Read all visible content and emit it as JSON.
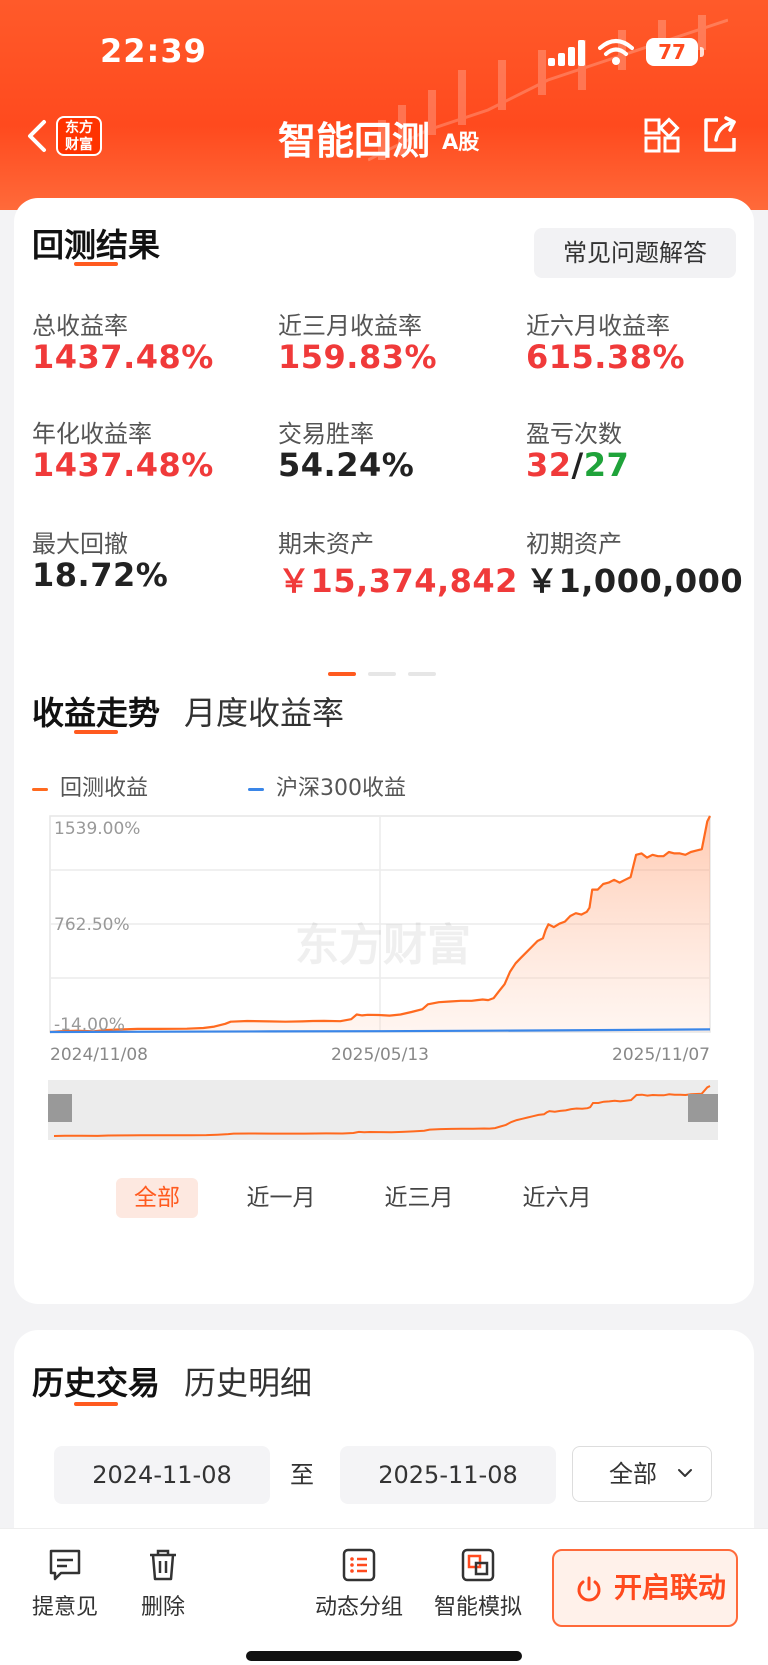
{
  "status": {
    "time": "22:39",
    "battery": "77"
  },
  "nav": {
    "logo_line1": "东方",
    "logo_line2": "财富",
    "title": "智能回测",
    "subtitle": "A股"
  },
  "results": {
    "title": "回测结果",
    "faq_label": "常见问题解答",
    "metrics": [
      {
        "label": "总收益率",
        "value": "1437.48%"
      },
      {
        "label": "近三月收益率",
        "value": "159.83%"
      },
      {
        "label": "近六月收益率",
        "value": "615.38%"
      },
      {
        "label": "年化收益率",
        "value": "1437.48%"
      },
      {
        "label": "交易胜率",
        "value": "54.24%"
      },
      {
        "label": "盈亏次数",
        "win": "32",
        "sep": "/",
        "loss": "27"
      },
      {
        "label": "最大回撤",
        "value": "18.72%"
      },
      {
        "label": "期末资产",
        "value": "￥15,374,842"
      },
      {
        "label": "初期资产",
        "value": "￥1,000,000"
      }
    ]
  },
  "trend": {
    "tab_active": "收益走势",
    "tab_other": "月度收益率",
    "legend_backtest": "回测收益",
    "legend_hs300": "沪深300收益",
    "watermark": "东方财富",
    "range_tabs": [
      "全部",
      "近一月",
      "近三月",
      "近六月"
    ]
  },
  "chart_data": {
    "type": "line",
    "y_ticks": [
      "1539.00%",
      "762.50%",
      "-14.00%"
    ],
    "x_ticks": [
      "2024/11/08",
      "2025/05/13",
      "2025/11/07"
    ],
    "ylim": [
      -14,
      1539
    ],
    "series": [
      {
        "name": "回测收益",
        "color": "#ff6a1f",
        "points": [
          [
            0,
            -14
          ],
          [
            0.02,
            -8
          ],
          [
            0.05,
            -5
          ],
          [
            0.08,
            -10
          ],
          [
            0.1,
            0
          ],
          [
            0.13,
            5
          ],
          [
            0.16,
            8
          ],
          [
            0.2,
            8
          ],
          [
            0.25,
            10
          ],
          [
            0.28,
            15
          ],
          [
            0.3,
            25
          ],
          [
            0.32,
            45
          ],
          [
            0.33,
            60
          ],
          [
            0.36,
            65
          ],
          [
            0.4,
            62
          ],
          [
            0.43,
            60
          ],
          [
            0.46,
            62
          ],
          [
            0.48,
            65
          ],
          [
            0.5,
            66
          ],
          [
            0.53,
            64
          ],
          [
            0.55,
            78
          ],
          [
            0.56,
            112
          ],
          [
            0.57,
            105
          ],
          [
            0.58,
            110
          ],
          [
            0.6,
            108
          ],
          [
            0.62,
            104
          ],
          [
            0.64,
            112
          ],
          [
            0.66,
            130
          ],
          [
            0.68,
            150
          ],
          [
            0.69,
            185
          ],
          [
            0.71,
            200
          ],
          [
            0.73,
            205
          ],
          [
            0.75,
            210
          ],
          [
            0.77,
            210
          ],
          [
            0.78,
            215
          ],
          [
            0.79,
            220
          ],
          [
            0.8,
            215
          ],
          [
            0.81,
            230
          ],
          [
            0.82,
            280
          ],
          [
            0.83,
            330
          ],
          [
            0.84,
            420
          ],
          [
            0.85,
            480
          ],
          [
            0.86,
            520
          ],
          [
            0.87,
            560
          ],
          [
            0.88,
            600
          ],
          [
            0.89,
            640
          ],
          [
            0.9,
            660
          ],
          [
            0.905,
            720
          ],
          [
            0.91,
            760
          ],
          [
            0.92,
            740
          ],
          [
            0.93,
            765
          ],
          [
            0.94,
            780
          ],
          [
            0.95,
            820
          ],
          [
            0.96,
            840
          ],
          [
            0.97,
            830
          ],
          [
            0.98,
            850
          ],
          [
            0.985,
            880
          ],
          [
            0.99,
            1010
          ],
          [
            1.0,
            1010
          ],
          [
            1.01,
            1050
          ],
          [
            1.02,
            1060
          ],
          [
            1.03,
            1080
          ],
          [
            1.04,
            1060
          ],
          [
            1.05,
            1080
          ],
          [
            1.06,
            1100
          ],
          [
            1.07,
            1260
          ],
          [
            1.08,
            1270
          ],
          [
            1.09,
            1240
          ],
          [
            1.1,
            1260
          ],
          [
            1.11,
            1250
          ],
          [
            1.12,
            1250
          ],
          [
            1.13,
            1280
          ],
          [
            1.14,
            1270
          ],
          [
            1.15,
            1270
          ],
          [
            1.16,
            1260
          ],
          [
            1.17,
            1280
          ],
          [
            1.18,
            1290
          ],
          [
            1.19,
            1300
          ],
          [
            1.2,
            1500
          ],
          [
            1.205,
            1539
          ]
        ]
      },
      {
        "name": "沪深300收益",
        "color": "#3a86e8",
        "points": [
          [
            0,
            -14
          ],
          [
            0.2,
            -12
          ],
          [
            0.4,
            -10
          ],
          [
            0.6,
            -8
          ],
          [
            0.8,
            -5
          ],
          [
            1.0,
            0
          ],
          [
            1.205,
            5
          ]
        ]
      }
    ]
  },
  "history": {
    "tab_active": "历史交易",
    "tab_other": "历史明细",
    "start_date": "2024-11-08",
    "to_label": "至",
    "end_date": "2025-11-08",
    "filter": "全部"
  },
  "bottom_bar": {
    "feedback": "提意见",
    "delete": "删除",
    "dynamic_group": "动态分组",
    "smart_sim": "智能模拟",
    "cta": "开启联动"
  }
}
